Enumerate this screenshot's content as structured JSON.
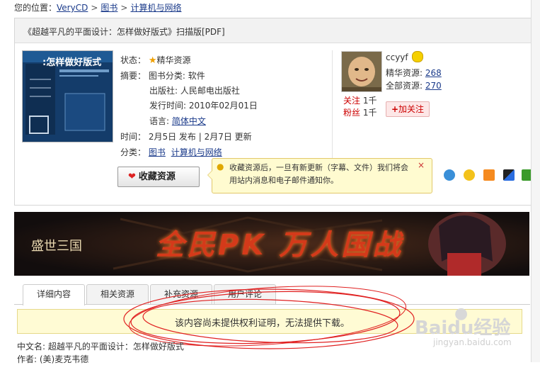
{
  "breadcrumb": {
    "prefix": "您的位置：",
    "items": [
      "VeryCD",
      "图书",
      "计算机与网络"
    ],
    "separator": ">"
  },
  "resource": {
    "title": "《超越平凡的平面设计：怎样做好版式》扫描版[PDF]",
    "cover_title": "超越平凡的平面设计：怎样做好版式",
    "status_label": "状态：",
    "status_value": "精华资源",
    "summary_label": "摘要：",
    "category_line": "图书分类: 软件",
    "publisher_line": "出版社: 人民邮电出版社",
    "pubdate_line": "发行时间: 2010年02月01日",
    "language_prefix": "语言: ",
    "language_value": "简体中文",
    "time_label": "时间：",
    "time_value": "2月5日 发布 | 2月7日 更新",
    "category_label": "分类：",
    "categories": [
      "图书",
      "计算机与网络"
    ]
  },
  "user": {
    "name": "ccyyf",
    "elite_label": "精华资源:",
    "elite_count": "268",
    "total_label": "全部资源:",
    "total_count": "270",
    "follow_label": "关注",
    "follow_count": "1千",
    "fans_label": "粉丝",
    "fans_count": "1千",
    "follow_button": "加关注"
  },
  "favorite": {
    "button_label": "收藏资源",
    "tooltip": "收藏资源后，一旦有新更新（字幕、文件）我们将会用站内消息和电子邮件通知你。",
    "close": "×"
  },
  "banner": {
    "logo": "盛世三国",
    "slogan": "全民PK 万人国战"
  },
  "tabs": [
    "详细内容",
    "相关资源",
    "补充资源",
    "用户评论"
  ],
  "notice": "该内容尚未提供权利证明，无法提供下载。",
  "details": {
    "cn_name_label": "中文名:",
    "cn_name_value": "超越平凡的平面设计：怎样做好版式",
    "author_label": "作者:",
    "author_value": "(美)麦克韦德"
  },
  "watermark": {
    "brand": "Baidu经验",
    "url": "jingyan.baidu.com"
  },
  "colors": {
    "link": "#1a3a8a",
    "accent_red": "#cc0000",
    "tooltip_bg": "#fffbd0",
    "notice_bg": "#fffbd4"
  }
}
